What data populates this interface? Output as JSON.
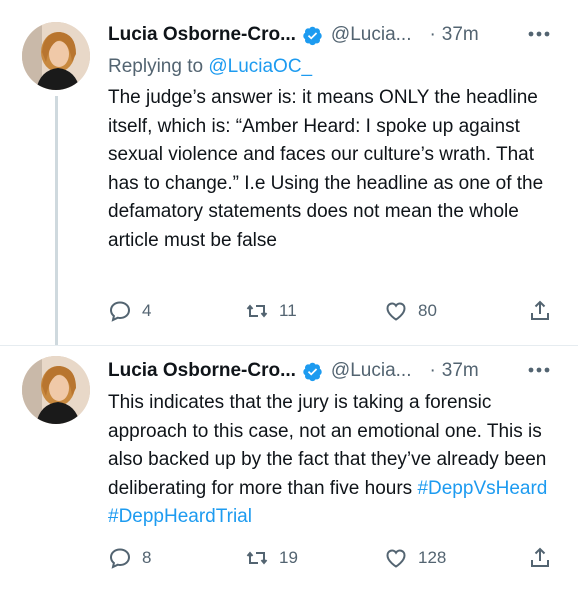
{
  "tweets": [
    {
      "author_name": "Lucia Osborne-Cro...",
      "handle": "@Lucia...",
      "separator": "·",
      "time": "37m",
      "replying_label": "Replying to",
      "replying_to": "@LuciaOC_",
      "text": "The judge’s answer is: it means ONLY the headline itself, which is: “Amber Heard: I spoke up against sexual violence and faces our culture’s wrath. That has to change.” I.e Using the headline as one of the defamatory statements does not mean the whole article must be false",
      "replies": "4",
      "retweets": "11",
      "likes": "80"
    },
    {
      "author_name": "Lucia Osborne-Cro...",
      "handle": "@Lucia...",
      "separator": "·",
      "time": "37m",
      "text": "This indicates that the jury is taking a forensic approach to this case, not an emotional one. This is also backed up by the fact that they’ve already been deliberating for more than five hours",
      "hashtags": [
        "#DeppVsHeard",
        "#DeppHeardTrial"
      ],
      "replies": "8",
      "retweets": "19",
      "likes": "128"
    }
  ],
  "colors": {
    "link": "#1d9bf0",
    "secondary_text": "#536471",
    "verified_badge": "#1d9bf0",
    "thread_line": "#cfd9de"
  },
  "icons": [
    "verified-badge-icon",
    "more-options-icon",
    "reply-icon",
    "retweet-icon",
    "like-icon",
    "share-icon"
  ]
}
